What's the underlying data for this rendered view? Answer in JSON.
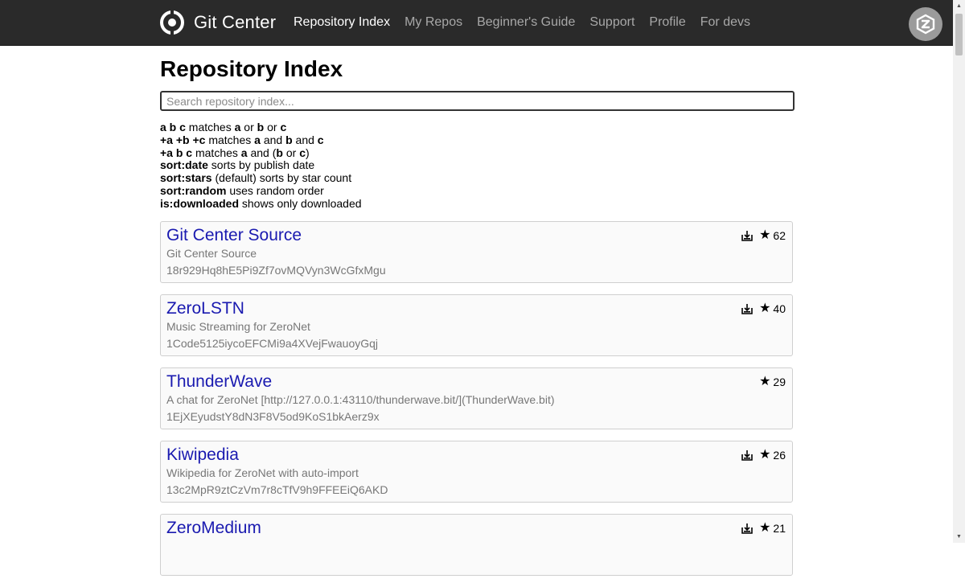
{
  "header": {
    "brand": "Git Center",
    "nav": [
      {
        "label": "Repository Index",
        "active": true
      },
      {
        "label": "My Repos",
        "active": false
      },
      {
        "label": "Beginner's Guide",
        "active": false
      },
      {
        "label": "Support",
        "active": false
      },
      {
        "label": "Profile",
        "active": false
      },
      {
        "label": "For devs",
        "active": false
      }
    ]
  },
  "main": {
    "title": "Repository Index",
    "search_placeholder": "Search repository index...",
    "search_value": "",
    "help": [
      [
        {
          "t": "a b c",
          "b": true
        },
        {
          "t": " matches ",
          "b": false
        },
        {
          "t": "a",
          "b": true
        },
        {
          "t": " or ",
          "b": false
        },
        {
          "t": "b",
          "b": true
        },
        {
          "t": " or ",
          "b": false
        },
        {
          "t": "c",
          "b": true
        }
      ],
      [
        {
          "t": "+a +b +c",
          "b": true
        },
        {
          "t": " matches ",
          "b": false
        },
        {
          "t": "a",
          "b": true
        },
        {
          "t": " and ",
          "b": false
        },
        {
          "t": "b",
          "b": true
        },
        {
          "t": " and ",
          "b": false
        },
        {
          "t": "c",
          "b": true
        }
      ],
      [
        {
          "t": "+a b c",
          "b": true
        },
        {
          "t": " matches ",
          "b": false
        },
        {
          "t": "a",
          "b": true
        },
        {
          "t": " and (",
          "b": false
        },
        {
          "t": "b",
          "b": true
        },
        {
          "t": " or ",
          "b": false
        },
        {
          "t": "c",
          "b": true
        },
        {
          "t": ")",
          "b": false
        }
      ],
      [
        {
          "t": "sort:date",
          "b": true
        },
        {
          "t": " sorts by publish date",
          "b": false
        }
      ],
      [
        {
          "t": "sort:stars",
          "b": true
        },
        {
          "t": " (default) sorts by star count",
          "b": false
        }
      ],
      [
        {
          "t": "sort:random",
          "b": true
        },
        {
          "t": " uses random order",
          "b": false
        }
      ],
      [
        {
          "t": "is:downloaded",
          "b": true
        },
        {
          "t": " shows only downloaded",
          "b": false
        }
      ]
    ],
    "repos": [
      {
        "name": "Git Center Source",
        "description": "Git Center Source",
        "address": "18r929Hq8hE5Pi9Zf7ovMQVyn3WcGfxMgu",
        "stars": "62",
        "downloaded": true
      },
      {
        "name": "ZeroLSTN",
        "description": "Music Streaming for ZeroNet",
        "address": "1Code5125iycoEFCMi9a4XVejFwauoyGqj",
        "stars": "40",
        "downloaded": true
      },
      {
        "name": "ThunderWave",
        "description": "A chat for ZeroNet [http://127.0.0.1:43110/thunderwave.bit/](ThunderWave.bit)",
        "address": "1EjXEyudstY8dN3F8V5od9KoS1bkAerz9x",
        "stars": "29",
        "downloaded": false
      },
      {
        "name": "Kiwipedia",
        "description": "Wikipedia for ZeroNet with auto-import",
        "address": "13c2MpR9ztCzVm7r8cTfV9h9FFEEiQ6AKD",
        "stars": "26",
        "downloaded": true
      },
      {
        "name": "ZeroMedium",
        "description": "",
        "address": "",
        "stars": "21",
        "downloaded": true
      }
    ]
  },
  "icons": {
    "logo": "git-center-logo-icon",
    "avatar": "zeronet-z-icon",
    "download": "downloaded-icon",
    "star": "star-icon"
  },
  "colors": {
    "topbar": "#2a2a2a",
    "nav_active": "#ffffff",
    "nav_inactive": "#a8a8a8",
    "repo_link": "#1a1ab0",
    "muted_text": "#777777"
  }
}
